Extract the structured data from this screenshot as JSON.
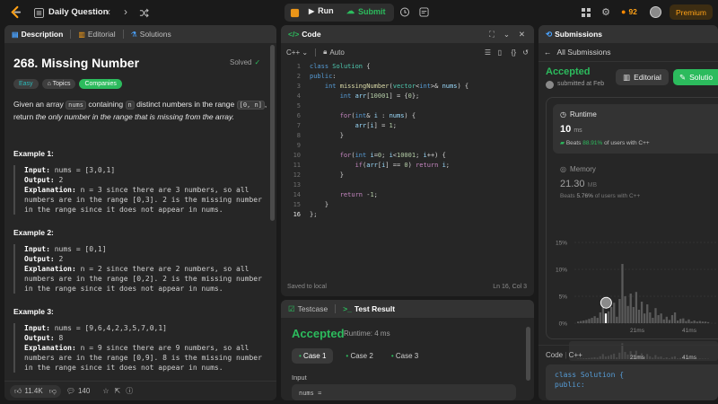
{
  "topbar": {
    "title": "Daily Question",
    "run_label": "Run",
    "submit_label": "Submit",
    "streak": "92",
    "premium_label": "Premium"
  },
  "left": {
    "tabs": [
      "Description",
      "Editorial",
      "Solutions"
    ],
    "problem_title": "268. Missing Number",
    "solved_label": "Solved",
    "tags": [
      "Easy",
      "Topics",
      "Companies"
    ],
    "desc_1": "Given an array",
    "desc_nums": "nums",
    "desc_2": "containing",
    "desc_n": "n",
    "desc_3": "distinct numbers in the range",
    "desc_range": "[0, n]",
    "desc_4": ",",
    "desc_5": "return",
    "desc_6": "the only number in the range that is missing from the array.",
    "examples": [
      {
        "title": "Example 1:",
        "input": "nums = [3,0,1]",
        "output": "2",
        "explanation": "n = 3 since there are 3 numbers, so all\nnumbers are in the range [0,3]. 2 is the missing number\nin the range since it does not appear in nums."
      },
      {
        "title": "Example 2:",
        "input": "nums = [0,1]",
        "output": "2",
        "explanation": "n = 2 since there are 2 numbers, so all\nnumbers are in the range [0,2]. 2 is the missing number\nin the range since it does not appear in nums."
      },
      {
        "title": "Example 3:",
        "input": "nums = [9,6,4,2,3,5,7,0,1]",
        "output": "8",
        "explanation": "n = 9 since there are 9 numbers, so all\nnumbers are in the range [0,9]. 8 is the missing number\nin the range since it does not appear in nums."
      }
    ],
    "input_label": "Input:",
    "output_label": "Output:",
    "explanation_label": "Explanation:",
    "likes": "11.4K",
    "comments": "140"
  },
  "code": {
    "tab": "Code",
    "language": "C++",
    "auto_label": "Auto",
    "line_numbers": [
      "1",
      "2",
      "3",
      "4",
      "5",
      "6",
      "7",
      "8",
      "9",
      "10",
      "11",
      "12",
      "13",
      "14",
      "15",
      "16"
    ],
    "saved": "Saved to local",
    "cursor": "Ln 16, Col 3"
  },
  "tests": {
    "tab_testcase": "Testcase",
    "tab_result": "Test Result",
    "status": "Accepted",
    "runtime": "Runtime: 4 ms",
    "cases": [
      "Case 1",
      "Case 2",
      "Case 3"
    ],
    "input_label": "Input",
    "input_value": "nums ="
  },
  "submissions": {
    "tab": "Submissions",
    "back_label": "All Submissions",
    "status": "Accepted",
    "submitted": "submitted at Feb",
    "editorial_btn": "Editorial",
    "solution_btn": "Solutio",
    "runtime_label": "Runtime",
    "runtime_value": "10",
    "runtime_unit": "ms",
    "beats_label": "Beats",
    "beats_value": "88.91%",
    "beats_tail": "of users with C++",
    "memory_label": "Memory",
    "memory_value": "21.30",
    "memory_unit": "MB",
    "mem_beats_value": "5.76%",
    "code_label": "Code",
    "code_lang": "C++",
    "code_preview": [
      "class Solution {",
      "public:"
    ]
  },
  "chart_data": {
    "type": "bar",
    "y_ticks": [
      "15%",
      "10%",
      "5%",
      "0%"
    ],
    "x_ticks": [
      "21ms",
      "41ms"
    ],
    "ylim": [
      0,
      15
    ],
    "values": [
      0.3,
      0.4,
      0.5,
      0.6,
      0.8,
      1.0,
      1.3,
      1.0,
      2.0,
      3.5,
      1.8,
      2.2,
      3.0,
      3.8,
      1.2,
      4.5,
      11.0,
      5.0,
      3.2,
      5.5,
      3.0,
      5.8,
      2.5,
      4.0,
      1.8,
      3.5,
      2.0,
      1.0,
      2.8,
      1.5,
      1.8,
      0.7,
      1.2,
      0.6,
      1.5,
      2.0,
      0.5,
      0.8,
      0.9,
      0.4,
      0.7,
      0.3,
      0.5,
      0.3,
      0.4,
      0.3,
      0.3,
      0.2
    ],
    "highlight_index": 10,
    "colors": {
      "bar": "#5a5a5a",
      "highlight": "#ffffff"
    }
  }
}
